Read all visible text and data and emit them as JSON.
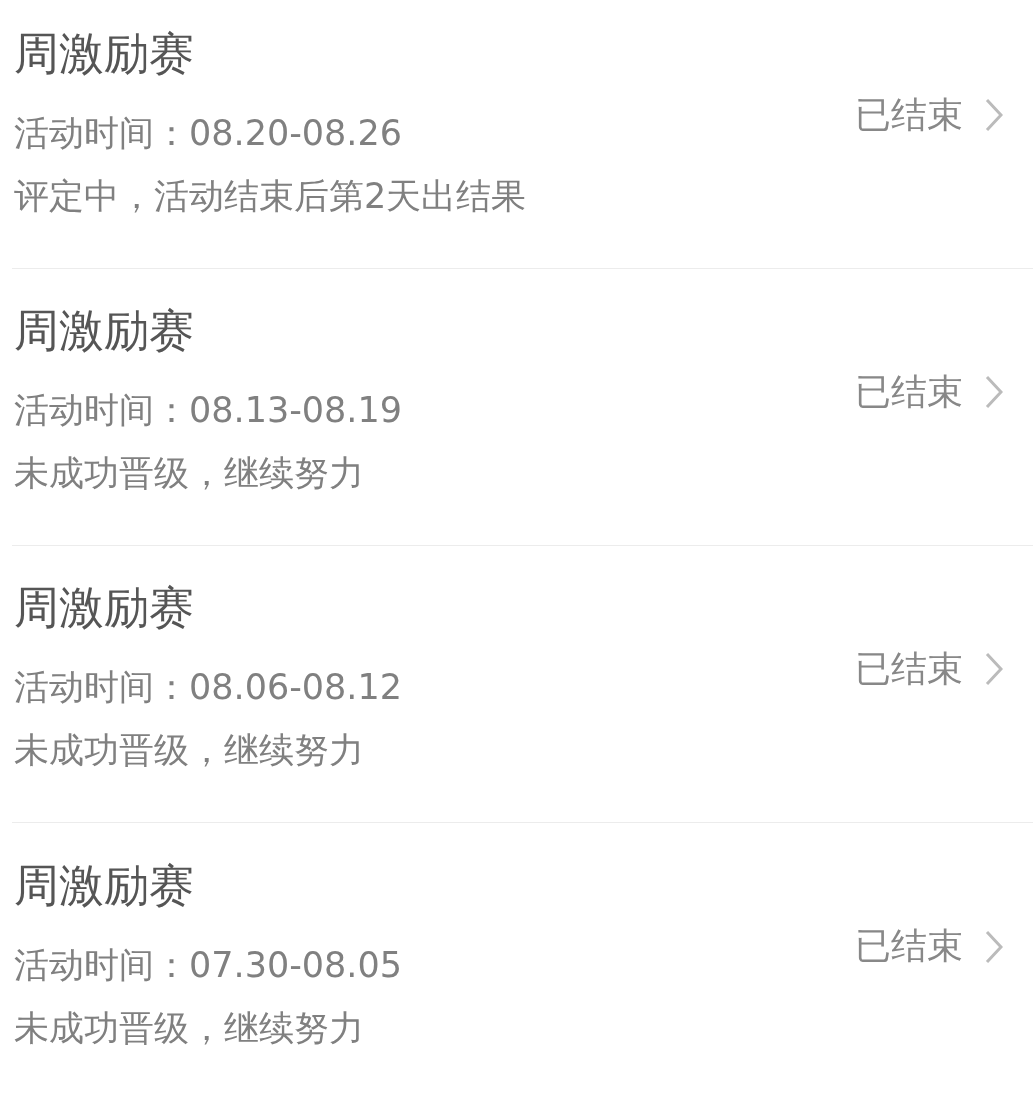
{
  "contests": [
    {
      "title": "周激励赛",
      "period": "活动时间：08.20-08.26",
      "result": "评定中，活动结束后第2天出结果",
      "status": "已结束"
    },
    {
      "title": "周激励赛",
      "period": "活动时间：08.13-08.19",
      "result": "未成功晋级，继续努力",
      "status": "已结束"
    },
    {
      "title": "周激励赛",
      "period": "活动时间：08.06-08.12",
      "result": "未成功晋级，继续努力",
      "status": "已结束"
    },
    {
      "title": "周激励赛",
      "period": "活动时间：07.30-08.05",
      "result": "未成功晋级，继续努力",
      "status": "已结束"
    }
  ]
}
